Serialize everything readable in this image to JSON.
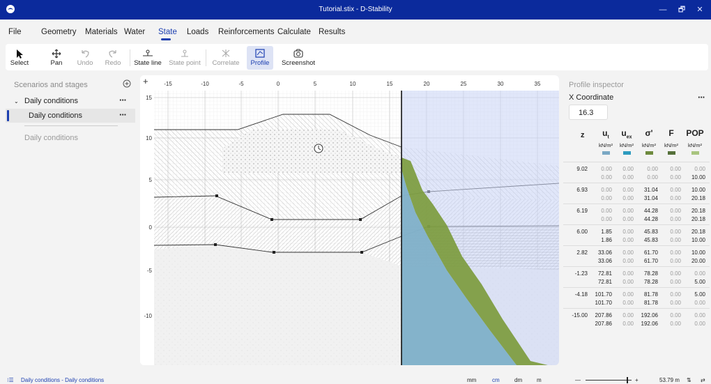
{
  "window": {
    "title": "Tutorial.stix - D-Stability",
    "minimize": "—",
    "maximize": "🗗",
    "close": "✕"
  },
  "menu": [
    "File",
    "Geometry",
    "Materials",
    "Water",
    "State",
    "Loads",
    "Reinforcements",
    "Calculate",
    "Results"
  ],
  "menu_active": "State",
  "ribbon": {
    "select": "Select",
    "pan": "Pan",
    "undo": "Undo",
    "redo": "Redo",
    "state_line": "State line",
    "state_point": "State point",
    "correlate": "Correlate",
    "profile": "Profile",
    "screenshot": "Screenshot"
  },
  "left_panel": {
    "title": "Scenarios and stages",
    "scenario": "Daily conditions",
    "stage_selected": "Daily conditions",
    "stage_other": "Daily conditions",
    "more": "···"
  },
  "canvas": {
    "plus": "+",
    "x_ticks": [
      "-15",
      "-10",
      "-5",
      "0",
      "5",
      "10",
      "15",
      "20",
      "25",
      "30",
      "35"
    ],
    "y_ticks": [
      "15",
      "10",
      "5",
      "0",
      "-5",
      "-10"
    ]
  },
  "inspector": {
    "title": "Profile inspector",
    "coord_label": "X Coordinate",
    "coord_value": "16.3",
    "more": "···",
    "z_header": "z",
    "columns": [
      {
        "main": "u",
        "sub": "t",
        "unit": "kN/m²",
        "color": "#7aa8c4"
      },
      {
        "main": "u",
        "sub": "ex",
        "unit": "kN/m²",
        "color": "#2d9bbf"
      },
      {
        "main": "σ'",
        "sub": "",
        "unit": "kN/m²",
        "color": "#6e8a3e"
      },
      {
        "main": "F",
        "sub": "",
        "unit": "kN/m²",
        "color": "#55703a"
      },
      {
        "main": "POP",
        "sub": "",
        "unit": "kN/m²",
        "color": "#a9c47f"
      }
    ],
    "rows": [
      {
        "z": "9.02",
        "top": [
          "0.00",
          "0.00",
          "0.00",
          "0.00",
          "0.00"
        ],
        "bot": [
          "0.00",
          "0.00",
          "0.00",
          "0.00",
          "10.00"
        ]
      },
      {
        "z": "6.93",
        "top": [
          "0.00",
          "0.00",
          "31.04",
          "0.00",
          "10.00"
        ],
        "bot": [
          "0.00",
          "0.00",
          "31.04",
          "0.00",
          "20.18"
        ]
      },
      {
        "z": "6.19",
        "top": [
          "0.00",
          "0.00",
          "44.28",
          "0.00",
          "20.18"
        ],
        "bot": [
          "0.00",
          "0.00",
          "44.28",
          "0.00",
          "20.18"
        ]
      },
      {
        "z": "6.00",
        "top": [
          "1.85",
          "0.00",
          "45.83",
          "0.00",
          "20.18"
        ],
        "bot": [
          "1.86",
          "0.00",
          "45.83",
          "0.00",
          "10.00"
        ]
      },
      {
        "z": "2.82",
        "top": [
          "33.06",
          "0.00",
          "61.70",
          "0.00",
          "10.00"
        ],
        "bot": [
          "33.06",
          "0.00",
          "61.70",
          "0.00",
          "20.00"
        ]
      },
      {
        "z": "-1.23",
        "top": [
          "72.81",
          "0.00",
          "78.28",
          "0.00",
          "0.00"
        ],
        "bot": [
          "72.81",
          "0.00",
          "78.28",
          "0.00",
          "5.00"
        ]
      },
      {
        "z": "-4.18",
        "top": [
          "101.70",
          "0.00",
          "81.78",
          "0.00",
          "5.00"
        ],
        "bot": [
          "101.70",
          "0.00",
          "81.78",
          "0.00",
          "0.00"
        ]
      },
      {
        "z": "-15.00",
        "top": [
          "207.86",
          "0.00",
          "192.06",
          "0.00",
          "0.00"
        ],
        "bot": [
          "207.86",
          "0.00",
          "192.06",
          "0.00",
          "0.00"
        ]
      }
    ]
  },
  "status": {
    "breadcrumb": "Daily conditions - Daily conditions",
    "units": [
      "mm",
      "cm",
      "dm",
      "m"
    ],
    "active_unit": "cm",
    "zoom_minus": "—",
    "zoom_plus": "+",
    "scale": "53.79 m"
  },
  "colors": {
    "accent": "#1c3fb0",
    "titlebar": "#0b2a9c"
  }
}
